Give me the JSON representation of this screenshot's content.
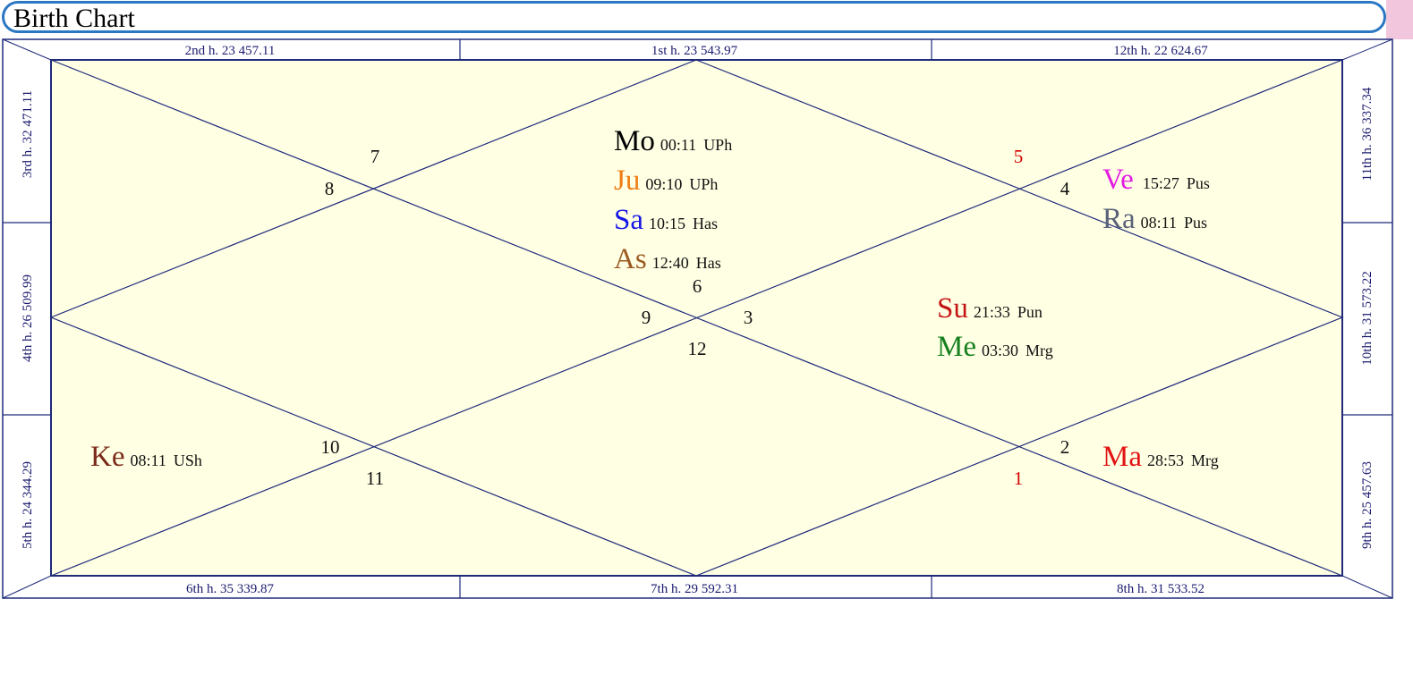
{
  "title": "Birth Chart",
  "colors": {
    "title_border": "#2b77c4",
    "title_strip": "#f2c7dd",
    "chart_fill": "#ffffe4",
    "line": "#1f2a7a",
    "edge_text": "#1a1a6e",
    "house_default": "#111111",
    "house_highlight": "#d40000"
  },
  "edges": {
    "top": [
      "2nd h.  23  457.11",
      "1st h.  23  543.97",
      "12th h.  22  624.67"
    ],
    "bottom": [
      "6th h.  35  339.87",
      "7th h.  29  592.31",
      "8th h.  31  533.52"
    ],
    "left": [
      "3rd h.  32  471.11",
      "4th h.  26  509.99",
      "5th h.  24  344.29"
    ],
    "right": [
      "11th h.  36  337.34",
      "10th h.  31  573.22",
      "9th h.  25  457.63"
    ]
  },
  "house_numbers": [
    {
      "key": "h7",
      "num": "7",
      "color": "#111111"
    },
    {
      "key": "h8",
      "num": "8",
      "color": "#111111"
    },
    {
      "key": "h5",
      "num": "5",
      "color": "#d40000"
    },
    {
      "key": "h4",
      "num": "4",
      "color": "#111111"
    },
    {
      "key": "h6",
      "num": "6",
      "color": "#111111"
    },
    {
      "key": "h9",
      "num": "9",
      "color": "#111111"
    },
    {
      "key": "h3",
      "num": "3",
      "color": "#111111"
    },
    {
      "key": "h12",
      "num": "12",
      "color": "#111111"
    },
    {
      "key": "h10",
      "num": "10",
      "color": "#111111"
    },
    {
      "key": "h11",
      "num": "11",
      "color": "#111111"
    },
    {
      "key": "h2",
      "num": "2",
      "color": "#111111"
    },
    {
      "key": "h1",
      "num": "1",
      "color": "#d40000"
    }
  ],
  "planets": [
    {
      "key": "mo",
      "abbr": "Mo",
      "degree": "00:11",
      "nakshatra": "UPh",
      "color": "#000000"
    },
    {
      "key": "ju",
      "abbr": "Ju",
      "degree": "09:10",
      "nakshatra": "UPh",
      "color": "#ee7d12"
    },
    {
      "key": "sa",
      "abbr": "Sa",
      "degree": "10:15",
      "nakshatra": "Has",
      "color": "#1717e6"
    },
    {
      "key": "as",
      "abbr": "As",
      "degree": "12:40",
      "nakshatra": "Has",
      "color": "#9b5a22"
    },
    {
      "key": "ve",
      "abbr": "Ve",
      "degree": "15:27",
      "nakshatra": "Pus",
      "color": "#e21ce0"
    },
    {
      "key": "ra",
      "abbr": "Ra",
      "degree": "08:11",
      "nakshatra": "Pus",
      "color": "#5a6278"
    },
    {
      "key": "su",
      "abbr": "Su",
      "degree": "21:33",
      "nakshatra": "Pun",
      "color": "#c41414"
    },
    {
      "key": "me",
      "abbr": "Me",
      "degree": "03:30",
      "nakshatra": "Mrg",
      "color": "#17801f"
    },
    {
      "key": "ke",
      "abbr": "Ke",
      "degree": "08:11",
      "nakshatra": "USh",
      "color": "#7b2a1a"
    },
    {
      "key": "ma",
      "abbr": "Ma",
      "degree": "28:53",
      "nakshatra": "Mrg",
      "color": "#e01414"
    }
  ]
}
